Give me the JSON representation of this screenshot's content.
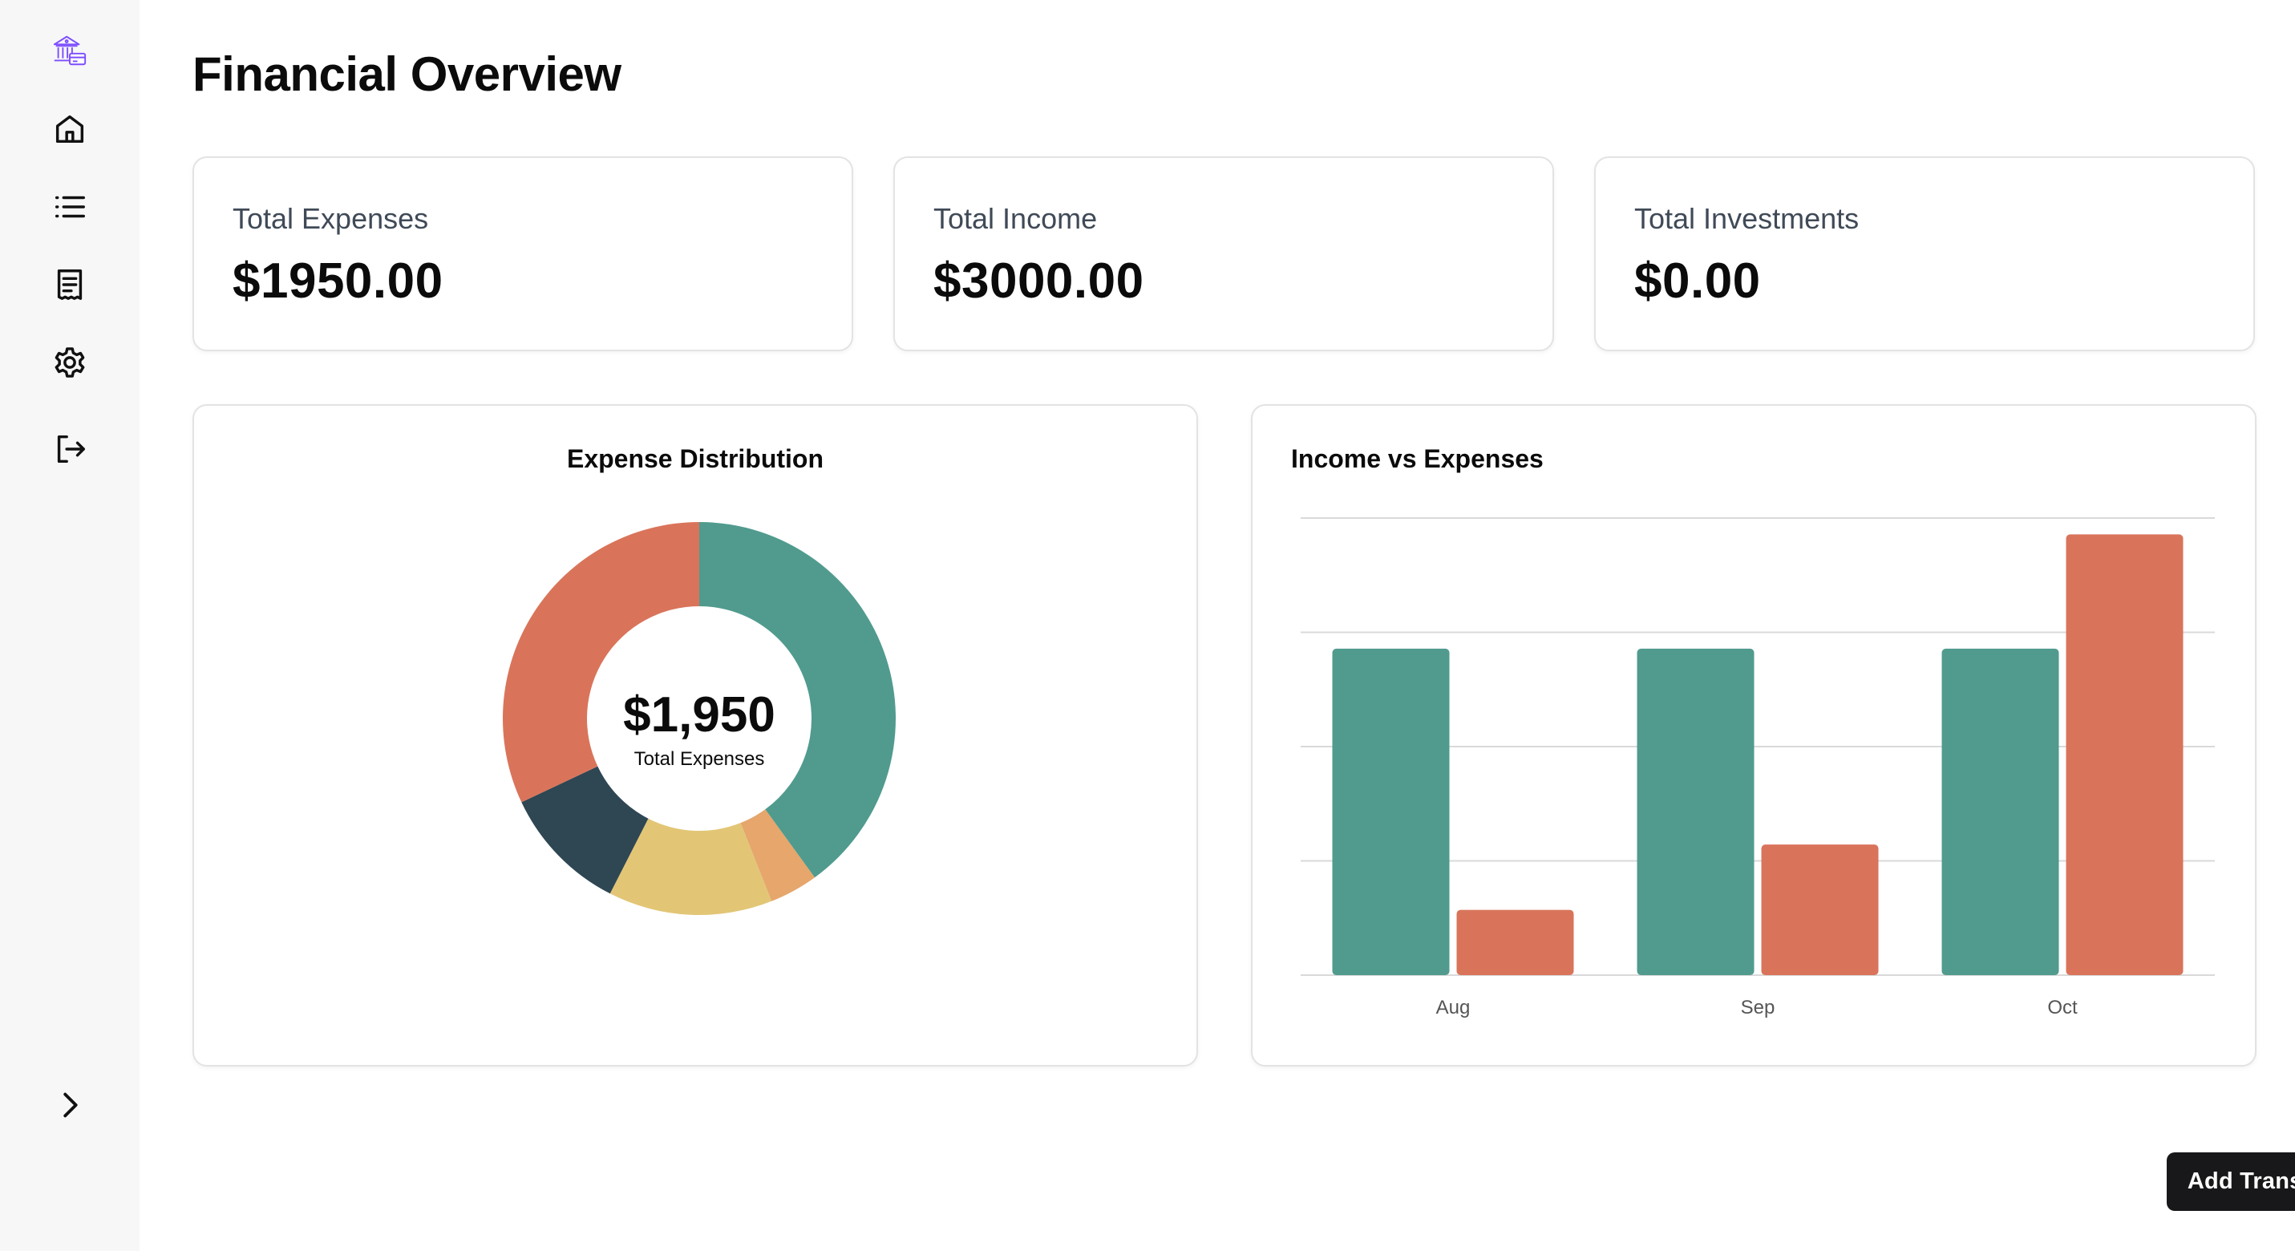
{
  "sidebar": {
    "icons": [
      "bank-card-logo-icon",
      "home-icon",
      "list-icon",
      "receipt-icon",
      "settings-icon",
      "logout-icon",
      "chevron-right-icon"
    ],
    "accent": "#7c4dff"
  },
  "header": {
    "title": "Financial Overview"
  },
  "stats": [
    {
      "label": "Total Expenses",
      "value": "$1950.00"
    },
    {
      "label": "Total Income",
      "value": "$3000.00"
    },
    {
      "label": "Total Investments",
      "value": "$0.00"
    }
  ],
  "expense_panel": {
    "title": "Expense Distribution",
    "center_value": "$1,950",
    "center_label": "Total Expenses"
  },
  "income_panel": {
    "title": "Income vs Expenses"
  },
  "chart_data": [
    {
      "type": "pie",
      "title": "Expense Distribution",
      "donut": true,
      "slices": [
        {
          "value": 0.4,
          "color": "#509b8e"
        },
        {
          "value": 0.04,
          "color": "#e6a66c"
        },
        {
          "value": 0.135,
          "color": "#e2c676"
        },
        {
          "value": 0.105,
          "color": "#2f4653"
        },
        {
          "value": 0.32,
          "color": "#d9745a"
        }
      ],
      "start_angle_deg": 90
    },
    {
      "type": "bar",
      "title": "Income vs Expenses",
      "categories": [
        "Aug",
        "Sep",
        "Oct"
      ],
      "series": [
        {
          "values": [
            1000,
            1000,
            1000
          ],
          "color": "#509b8e"
        },
        {
          "values": [
            200,
            400,
            1350
          ],
          "color": "#d9745a"
        }
      ],
      "ylim": [
        0,
        1400
      ],
      "gridlines": [
        0,
        350,
        700,
        1050,
        1400
      ],
      "grid": true,
      "legend": "none"
    }
  ],
  "actions": {
    "add_transaction": "Add Transaction"
  }
}
